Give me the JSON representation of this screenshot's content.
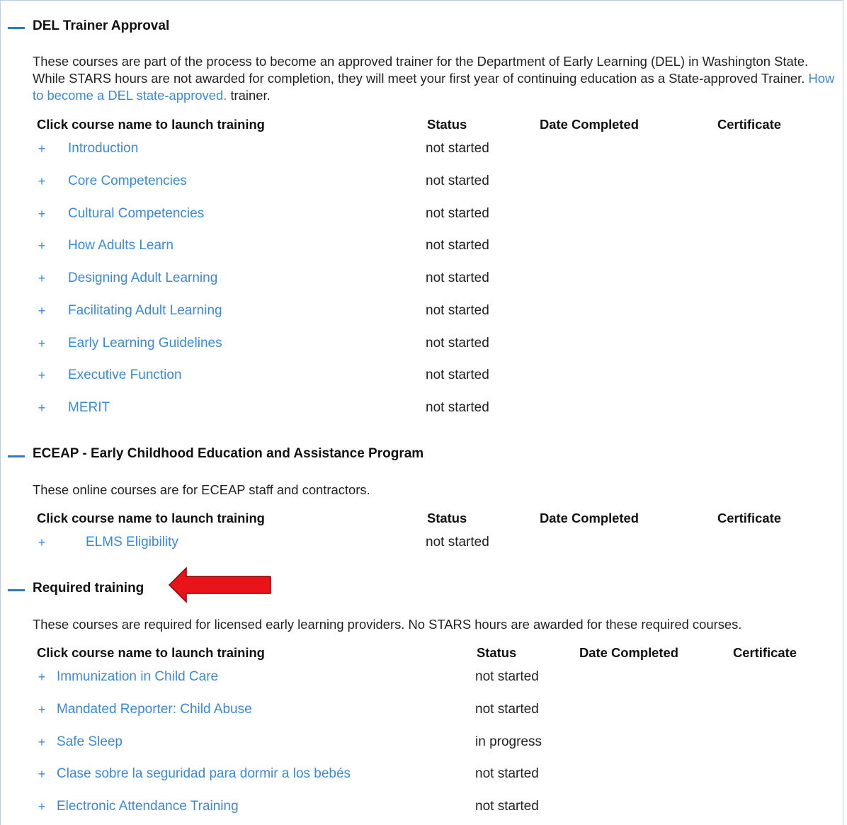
{
  "sections": [
    {
      "title": "DEL Trainer Approval",
      "description_before": "These courses are part of the process to become an approved trainer for the Department of Early Learning (DEL) in Washington State. While STARS hours are not awarded for completion, they will meet your first year of continuing education as a State-approved Trainer. ",
      "description_link": "How to become a DEL state-approved.",
      "description_after": " trainer.",
      "headers": {
        "course": "Click course name to launch training",
        "status": "Status",
        "date": "Date Completed",
        "certificate": "Certificate"
      },
      "courses": [
        {
          "name": "Introduction",
          "status": "not started"
        },
        {
          "name": "Core Competencies",
          "status": "not started"
        },
        {
          "name": "Cultural Competencies",
          "status": "not started"
        },
        {
          "name": "How Adults Learn",
          "status": "not started"
        },
        {
          "name": "Designing Adult Learning",
          "status": "not started"
        },
        {
          "name": "Facilitating Adult Learning",
          "status": "not started"
        },
        {
          "name": "Early Learning Guidelines",
          "status": "not started"
        },
        {
          "name": "Executive Function",
          "status": "not started"
        },
        {
          "name": "MERIT",
          "status": "not started"
        }
      ]
    },
    {
      "title": "ECEAP - Early Childhood Education and Assistance Program",
      "description": "These online courses are for ECEAP staff and contractors.",
      "headers": {
        "course": "Click course name to launch training",
        "status": "Status",
        "date": "Date Completed",
        "certificate": "Certificate"
      },
      "courses": [
        {
          "name": "ELMS Eligibility",
          "status": "not started"
        }
      ]
    },
    {
      "title": "Required training",
      "description": "These courses are required for licensed early learning providers. No STARS hours are awarded for these required courses.",
      "headers": {
        "course": "Click course name to launch training",
        "status": "Status",
        "date": "Date Completed",
        "certificate": "Certificate"
      },
      "courses": [
        {
          "name": "Immunization in Child Care",
          "status": "not started"
        },
        {
          "name": "Mandated Reporter: Child Abuse",
          "status": "not started"
        },
        {
          "name": "Safe Sleep",
          "status": "in progress"
        },
        {
          "name": "Clase sobre la seguridad para dormir a los bebés",
          "status": "not started"
        },
        {
          "name": "Electronic Attendance Training",
          "status": "not started"
        }
      ]
    }
  ],
  "expand_symbol": "+",
  "colors": {
    "link": "#3a8ad4",
    "toggle": "#2b7dc3",
    "arrow": "#e8141a",
    "arrow_outline": "#8b0000"
  }
}
